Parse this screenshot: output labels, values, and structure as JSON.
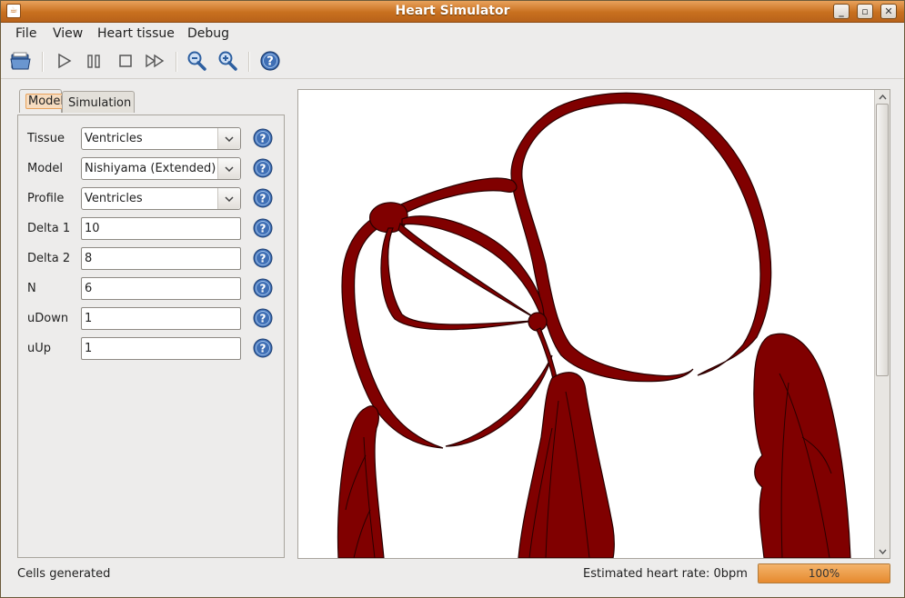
{
  "window": {
    "title": "Heart Simulator"
  },
  "menu": [
    "File",
    "View",
    "Heart tissue",
    "Debug"
  ],
  "toolbar": {
    "buttons": [
      "open-icon",
      "play-icon",
      "pause-icon",
      "stop-icon",
      "fast-forward-icon",
      "zoom-out-icon",
      "zoom-in-icon",
      "help-icon"
    ]
  },
  "tabs": [
    {
      "label": "Model",
      "active": true
    },
    {
      "label": "Simulation",
      "active": false
    }
  ],
  "form": {
    "tissue": {
      "label": "Tissue",
      "value": "Ventricles"
    },
    "model": {
      "label": "Model",
      "value": "Nishiyama (Extended)"
    },
    "profile": {
      "label": "Profile",
      "value": "Ventricles"
    },
    "delta1": {
      "label": "Delta 1",
      "value": "10"
    },
    "delta2": {
      "label": "Delta 2",
      "value": "8"
    },
    "n": {
      "label": "N",
      "value": "6"
    },
    "udown": {
      "label": "uDown",
      "value": "1"
    },
    "uup": {
      "label": "uUp",
      "value": "1"
    }
  },
  "status": {
    "message": "Cells generated",
    "heart_rate": "Estimated heart rate: 0bpm",
    "progress_text": "100%",
    "progress_value": 1.0
  },
  "colors": {
    "tissue": "#800000",
    "accent": "#e68a2e"
  }
}
